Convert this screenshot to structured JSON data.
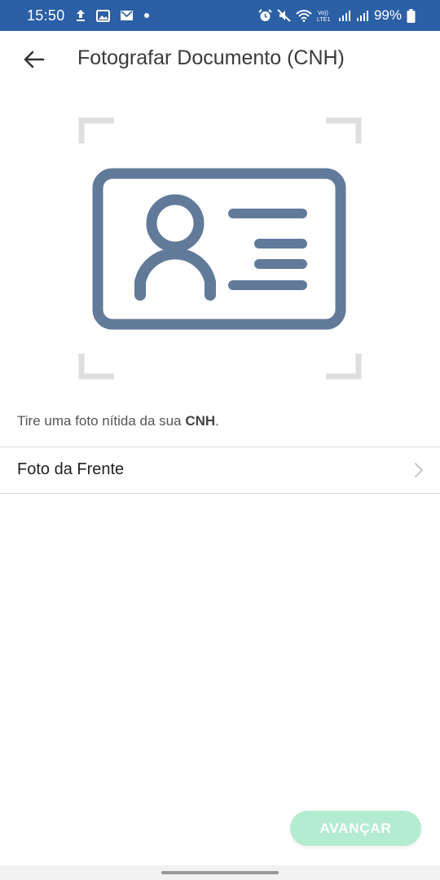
{
  "status_bar": {
    "time": "15:50",
    "battery": "99%",
    "background": "#2b5fa6",
    "icons_left": [
      "upload-icon",
      "gallery-icon",
      "mail-icon",
      "dot-icon"
    ],
    "icons_right": [
      "alarm-icon",
      "mute-icon",
      "wifi-icon",
      "volte-icon",
      "signal-icon",
      "signal-icon",
      "battery-icon"
    ],
    "volte_label": "Vo)) LTE1"
  },
  "app_bar": {
    "back_icon": "arrow-left-icon",
    "title": "Fotografar Documento (CNH)"
  },
  "illustration": {
    "icon": "id-card-icon",
    "color": "#627a9a",
    "frame_color": "#dedede"
  },
  "hint": {
    "prefix": "Tire uma foto nítida da sua ",
    "emphasis": "CNH",
    "suffix": "."
  },
  "list": {
    "items": [
      {
        "label": "Foto da Frente",
        "icon": "chevron-right-icon"
      }
    ]
  },
  "footer": {
    "advance_label": "AVANÇAR",
    "advance_color": "#b4ecd2"
  }
}
